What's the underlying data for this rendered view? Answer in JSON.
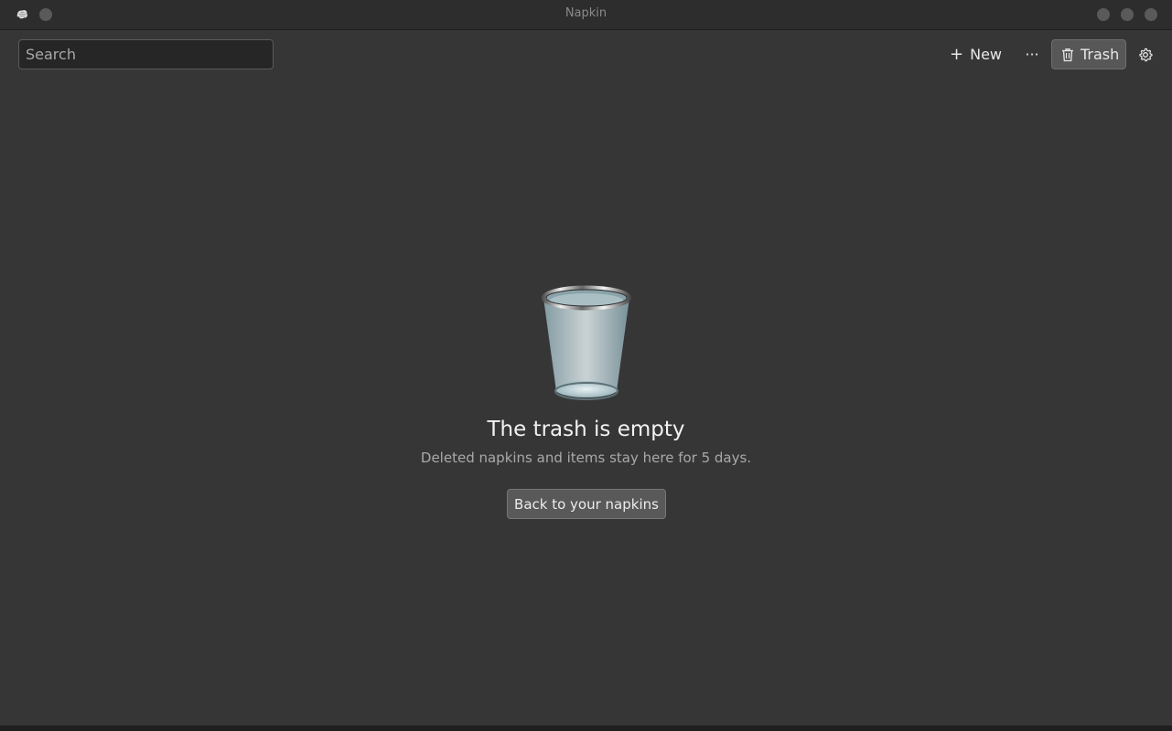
{
  "window": {
    "title": "Napkin",
    "logo_icon": "napkin-logo-icon"
  },
  "toolbar": {
    "search_placeholder": "Search",
    "search_value": "",
    "new_icon": "+",
    "new_label": "New",
    "more_label": "···",
    "trash_label": "Trash",
    "settings_icon": "gear-icon"
  },
  "empty_state": {
    "illustration": "trash-can-icon",
    "title": "The trash is empty",
    "subtitle": "Deleted napkins and items stay here for 5 days.",
    "back_button_label": "Back to your napkins"
  },
  "colors": {
    "background": "#363636",
    "titlebar": "#2d2d2d",
    "active_button": "#575757"
  }
}
